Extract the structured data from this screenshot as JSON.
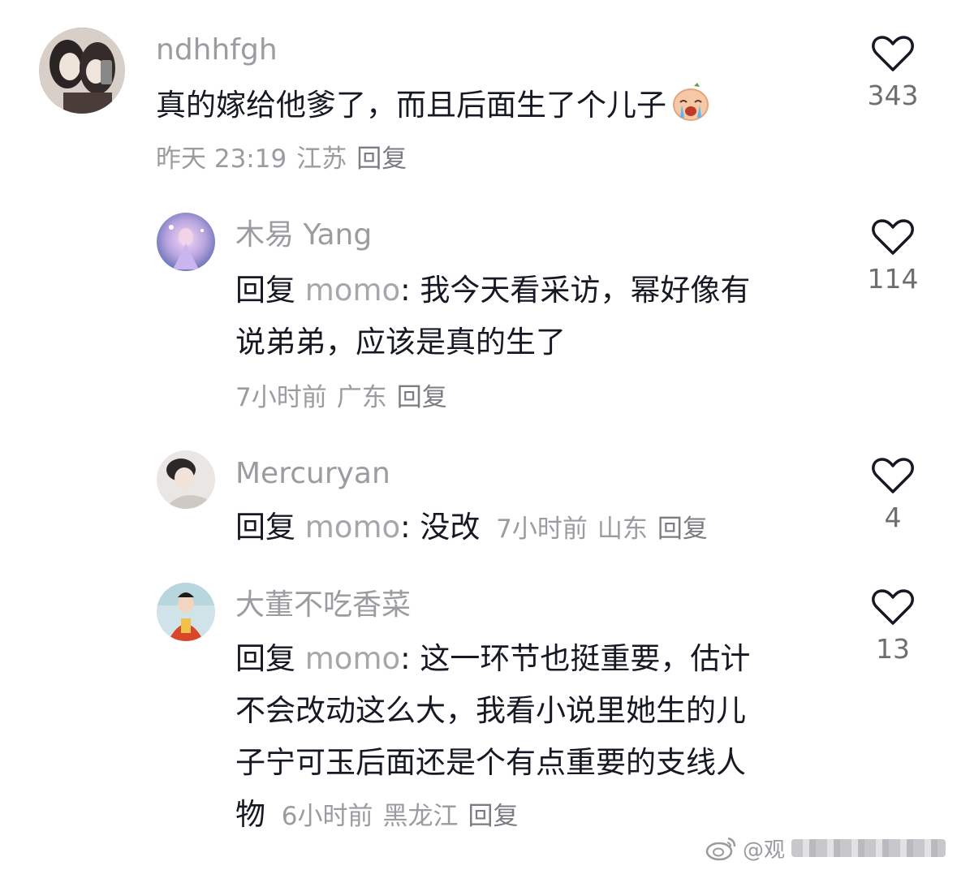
{
  "comments": [
    {
      "username": "ndhhfgh",
      "text": "真的嫁给他爹了，而且后面生了个儿子",
      "emoji": "crying-face-sticker",
      "time": "昨天 23:19",
      "location": "江苏",
      "reply_label": "回复",
      "likes": "343"
    },
    {
      "username": "木易 Yang",
      "reply_prefix": "回复",
      "mention": "momo",
      "separator": ": ",
      "text_line1": "我今天看采访，幂好像有",
      "text_line2": "说弟弟，应该是真的生了",
      "time": "7小时前",
      "location": "广东",
      "reply_label": "回复",
      "likes": "114"
    },
    {
      "username": "Mercuryan",
      "reply_prefix": "回复",
      "mention": "momo",
      "separator": ": ",
      "text": "没改",
      "time": "7小时前",
      "location": "山东",
      "reply_label": "回复",
      "likes": "4"
    },
    {
      "username": "大董不吃香菜",
      "reply_prefix": "回复",
      "mention": "momo",
      "separator": ": ",
      "text_line1": "这一环节也挺重要，估计",
      "text_line2": "不会改动这么大，我看小说里她生的儿",
      "text_line3": "子宁可玉后面还是个有点重要的支线人",
      "text_line4": "物",
      "time": "6小时前",
      "location": "黑龙江",
      "reply_label": "回复",
      "likes": "13"
    }
  ],
  "watermark": {
    "prefix": "@观",
    "icon": "weibo-logo-icon"
  },
  "colors": {
    "username": "#9b9ba0",
    "text": "#161823",
    "meta": "#9b9ba0",
    "heart_outline": "#161823"
  }
}
